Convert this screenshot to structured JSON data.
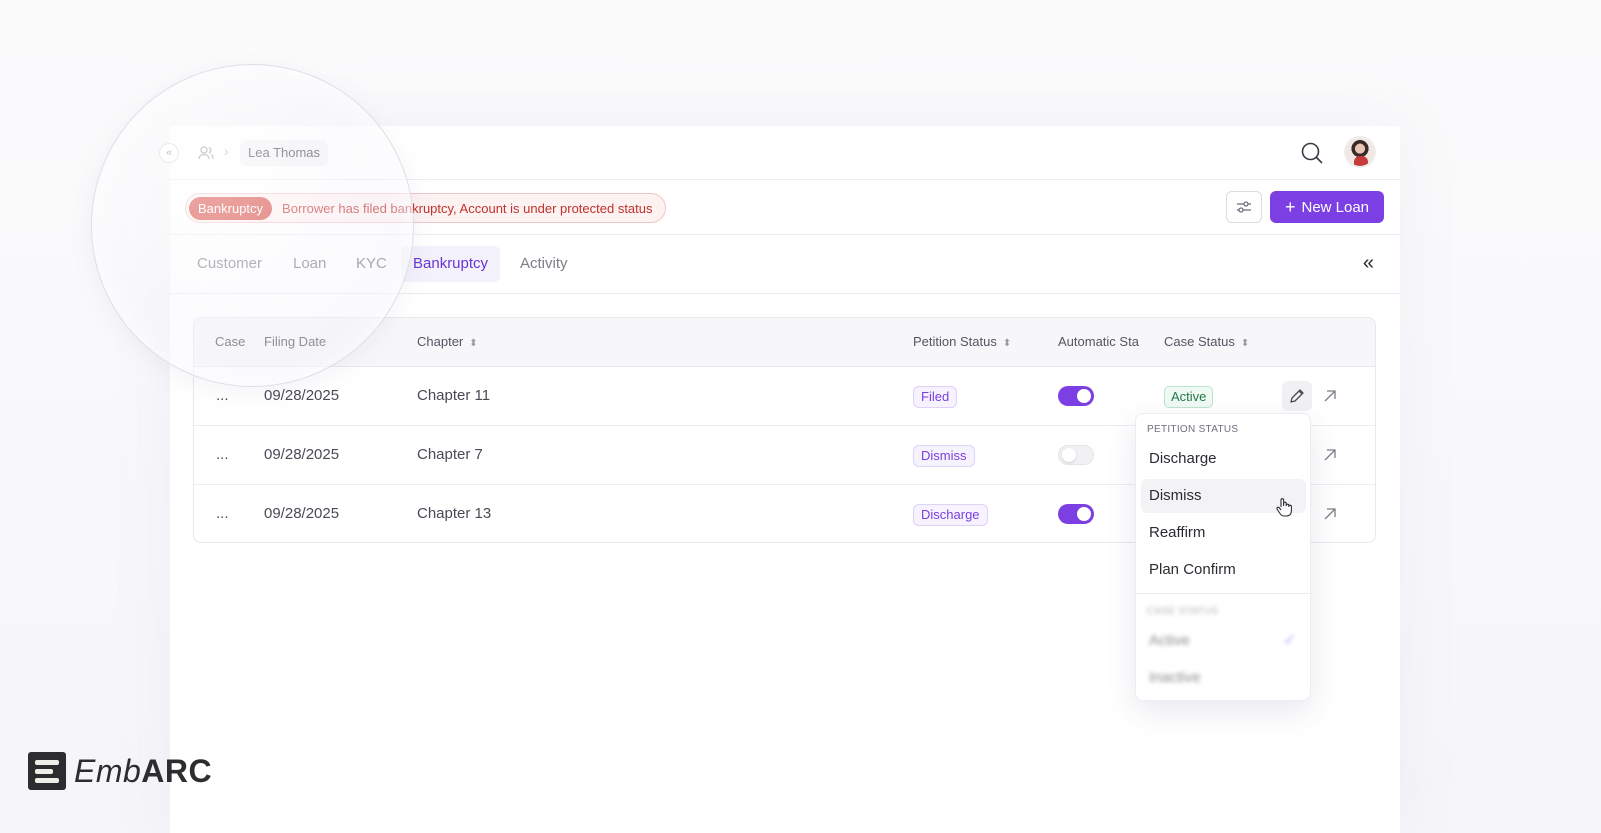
{
  "breadcrumb": {
    "name": "Lea Thomas"
  },
  "alert": {
    "badge": "Bankruptcy",
    "message": "Borrower has filed bankruptcy, Account is under protected status"
  },
  "actions": {
    "new_loan_label": "New Loan"
  },
  "tabs": [
    {
      "label": "Customer"
    },
    {
      "label": "Loan"
    },
    {
      "label": "KYC"
    },
    {
      "label": "Bankruptcy"
    },
    {
      "label": "Activity"
    }
  ],
  "table": {
    "columns": [
      "Case",
      "Filing Date",
      "Chapter",
      "Petition Status",
      "Automatic Sta",
      "Case Status"
    ],
    "rows": [
      {
        "case": "...",
        "filing_date": "09/28/2025",
        "chapter": "Chapter 11",
        "petition_status": "Filed",
        "automatic_stay": true,
        "case_status": "Active"
      },
      {
        "case": "...",
        "filing_date": "09/28/2025",
        "chapter": "Chapter 7",
        "petition_status": "Dismiss",
        "automatic_stay": false,
        "case_status": ""
      },
      {
        "case": "...",
        "filing_date": "09/28/2025",
        "chapter": "Chapter 13",
        "petition_status": "Discharge",
        "automatic_stay": true,
        "case_status": ""
      }
    ]
  },
  "dropdown": {
    "petition_section": "PETITION STATUS",
    "petition_options": [
      "Discharge",
      "Dismiss",
      "Reaffirm",
      "Plan Confirm"
    ],
    "case_section": "CASE STATUS",
    "case_options": [
      "Active",
      "Inactive"
    ],
    "selected_case_status": "Active",
    "hovered_option": "Dismiss"
  },
  "brand": {
    "light": "Emb",
    "bold": "ARC"
  },
  "colors": {
    "accent": "#7b3fe4",
    "alert_red": "#d8443c",
    "active_green": "#26774a"
  },
  "icons": [
    "collapse-left-icon",
    "user-group-icon",
    "chevron-right-icon",
    "search-icon",
    "filter-sliders-icon",
    "plus-icon",
    "double-chevron-left-icon",
    "sort-icon",
    "pencil-icon",
    "arrow-up-right-icon",
    "check-icon",
    "hand-cursor-icon"
  ]
}
